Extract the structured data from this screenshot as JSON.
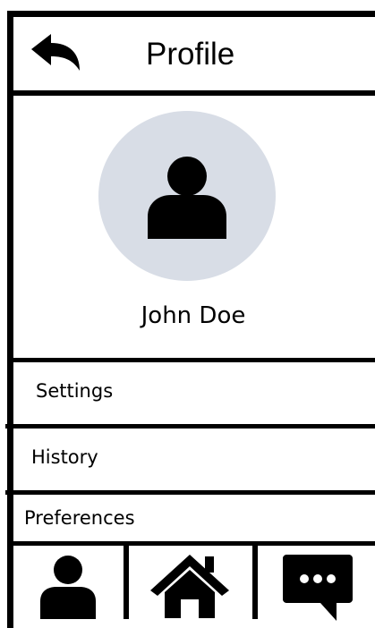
{
  "header": {
    "title": "Profile"
  },
  "profile": {
    "name": "John Doe"
  },
  "menu": {
    "items": [
      {
        "label": "Settings"
      },
      {
        "label": "History"
      },
      {
        "label": "Preferences"
      }
    ]
  },
  "icons": {
    "back": "back-arrow-icon",
    "avatar": "user-icon",
    "nav_profile": "user-icon",
    "nav_home": "home-icon",
    "nav_messages": "chat-bubble-icon"
  },
  "colors": {
    "avatar_background": "#d8dde6",
    "stroke": "#000000"
  }
}
